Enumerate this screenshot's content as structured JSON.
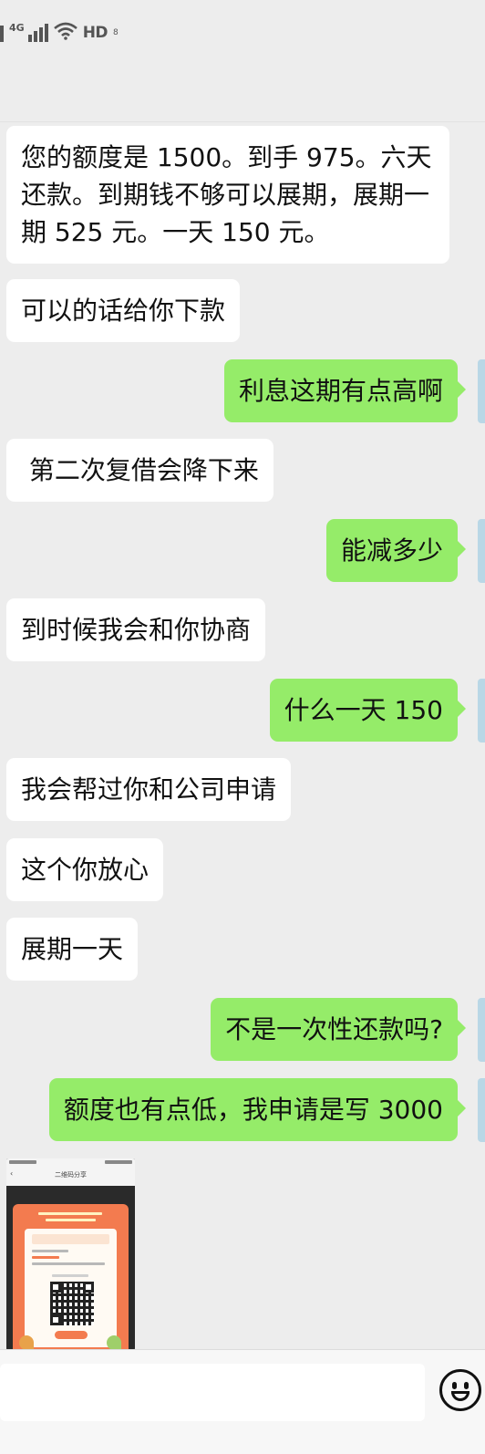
{
  "status_bar": {
    "network_label": "4G",
    "hd_label": "HD",
    "hd_sub": "8"
  },
  "messages": [
    {
      "side": "left",
      "text": "您的额度是 1500。到手 975。六天还款。到期钱不够可以展期，展期一期 525 元。一天 150 元。"
    },
    {
      "side": "left",
      "text": "可以的话给你下款"
    },
    {
      "side": "right",
      "text": "利息这期有点高啊"
    },
    {
      "side": "left",
      "text": " 第二次复借会降下来"
    },
    {
      "side": "right",
      "text": "能减多少"
    },
    {
      "side": "left",
      "text": "到时候我会和你协商"
    },
    {
      "side": "right",
      "text": "什么一天 150"
    },
    {
      "side": "left",
      "text": "我会帮过你和公司申请"
    },
    {
      "side": "left",
      "text": "这个你放心"
    },
    {
      "side": "left",
      "text": "展期一天"
    },
    {
      "side": "right",
      "text": "不是一次性还款吗?"
    },
    {
      "side": "right",
      "text": "额度也有点低，我申请是写 3000"
    }
  ],
  "image_message": {
    "kind": "screenshot",
    "inner_title": "二维码分享"
  },
  "input_bar": {
    "value": "",
    "emoji_icon": "smiley-icon"
  },
  "colors": {
    "background": "#ededed",
    "sent_bubble": "#95ec69",
    "received_bubble": "#ffffff"
  }
}
